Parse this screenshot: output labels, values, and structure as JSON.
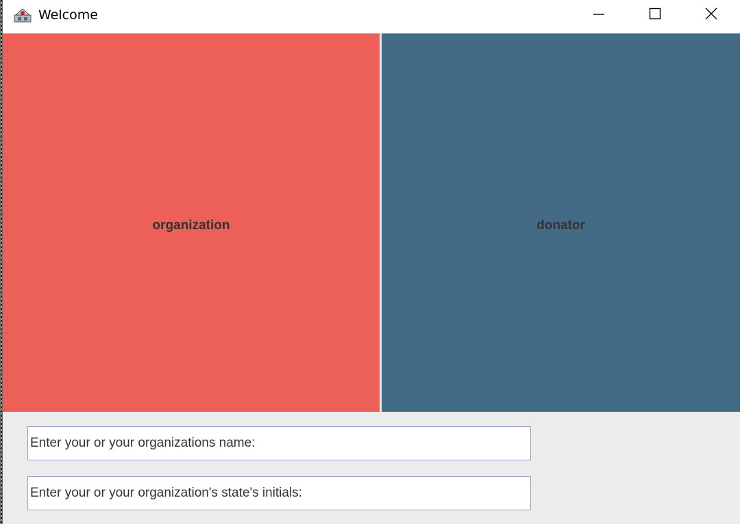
{
  "window": {
    "title": "Welcome",
    "icon": "java-app-icon",
    "controls": {
      "minimize": "minimize-icon",
      "maximize": "maximize-icon",
      "close": "close-icon"
    }
  },
  "panels": {
    "organization": {
      "label": "organization",
      "color": "#ec6058"
    },
    "donator": {
      "label": "donator",
      "color": "#446b86"
    }
  },
  "form": {
    "name_field": {
      "value": "Enter your or your organizations name:"
    },
    "state_field": {
      "value": "Enter your or your organization's state's initials:"
    }
  }
}
